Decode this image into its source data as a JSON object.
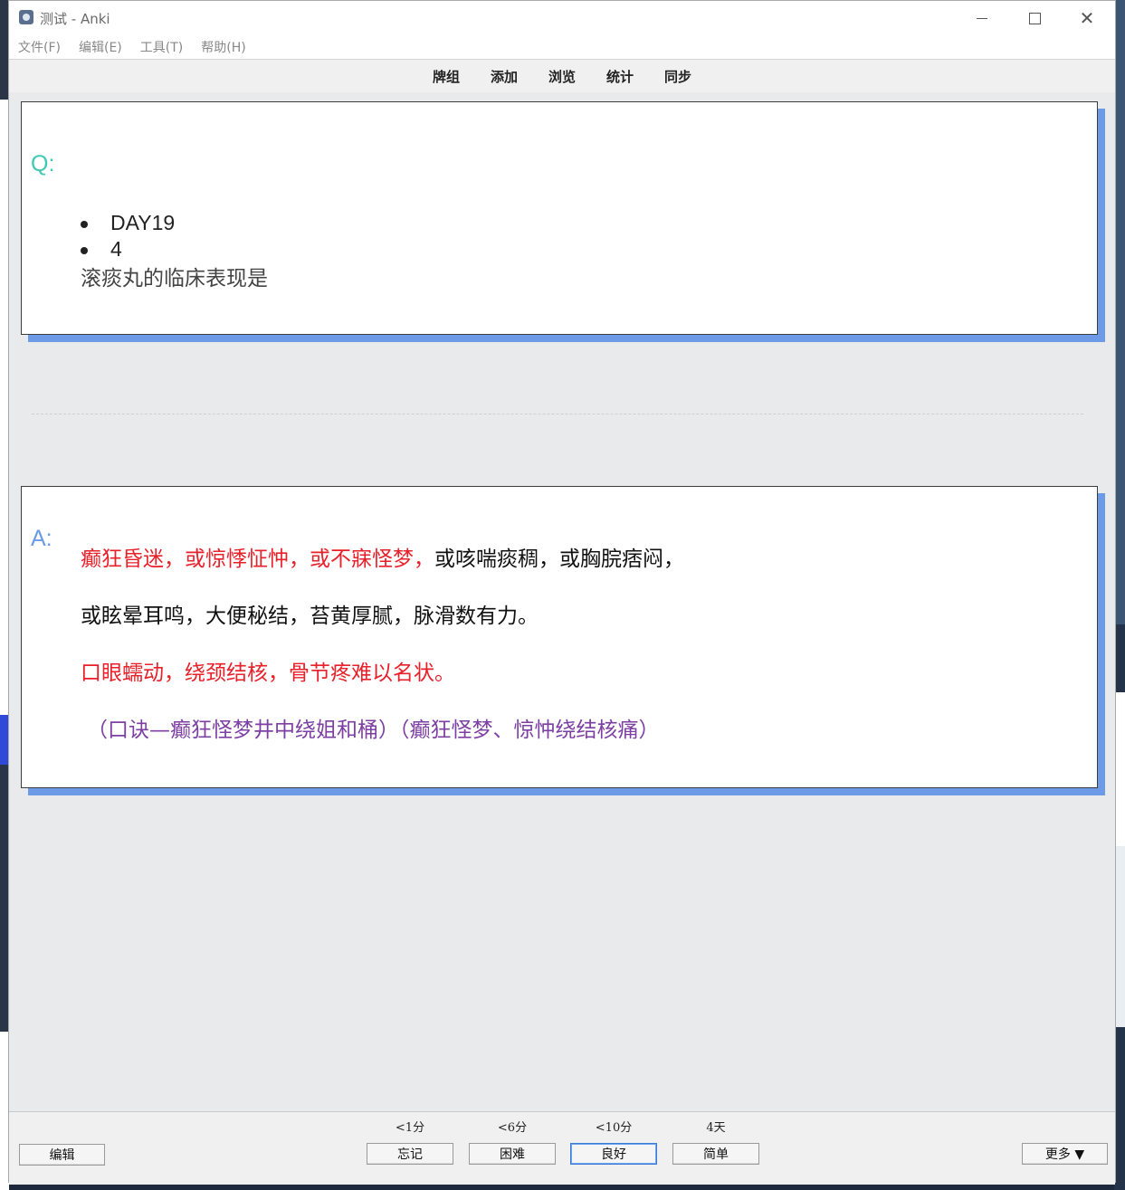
{
  "window": {
    "title": "测试 - Anki"
  },
  "menu": {
    "items": [
      "文件(F)",
      "编辑(E)",
      "工具(T)",
      "帮助(H)"
    ]
  },
  "toolbar": {
    "links": [
      "牌组",
      "添加",
      "浏览",
      "统计",
      "同步"
    ]
  },
  "question": {
    "label": "Q:",
    "bullets": [
      "DAY19",
      "4"
    ],
    "text": "滚痰丸的临床表现是"
  },
  "answer": {
    "label": "A:",
    "line1_red": "癫狂昏迷，或惊悸怔忡，或不寐怪梦，",
    "line1_black": "或咳喘痰稠，或胸脘痞闷，",
    "line2": "或眩晕耳鸣，大便秘结，苔黄厚腻，脉滑数有力。",
    "line3": "口眼蠕动，绕颈结核，骨节疼难以名状。",
    "line4": "（口诀—癫狂怪梦井中绕姐和桶）（癫狂怪梦、惊忡绕结核痛）"
  },
  "bottom": {
    "edit_label": "编辑",
    "more_label": "更多 ▼",
    "answers": [
      {
        "interval": "<1分",
        "label": "忘记"
      },
      {
        "interval": "<6分",
        "label": "困难"
      },
      {
        "interval": "<10分",
        "label": "良好"
      },
      {
        "interval": "4天",
        "label": "简单"
      }
    ]
  },
  "colors": {
    "accent_shadow": "#6c9ae6",
    "q_label": "#3fc8b4",
    "a_label": "#6c9ae6",
    "red_text": "#e8202a",
    "purple_text": "#7d3fa3"
  }
}
